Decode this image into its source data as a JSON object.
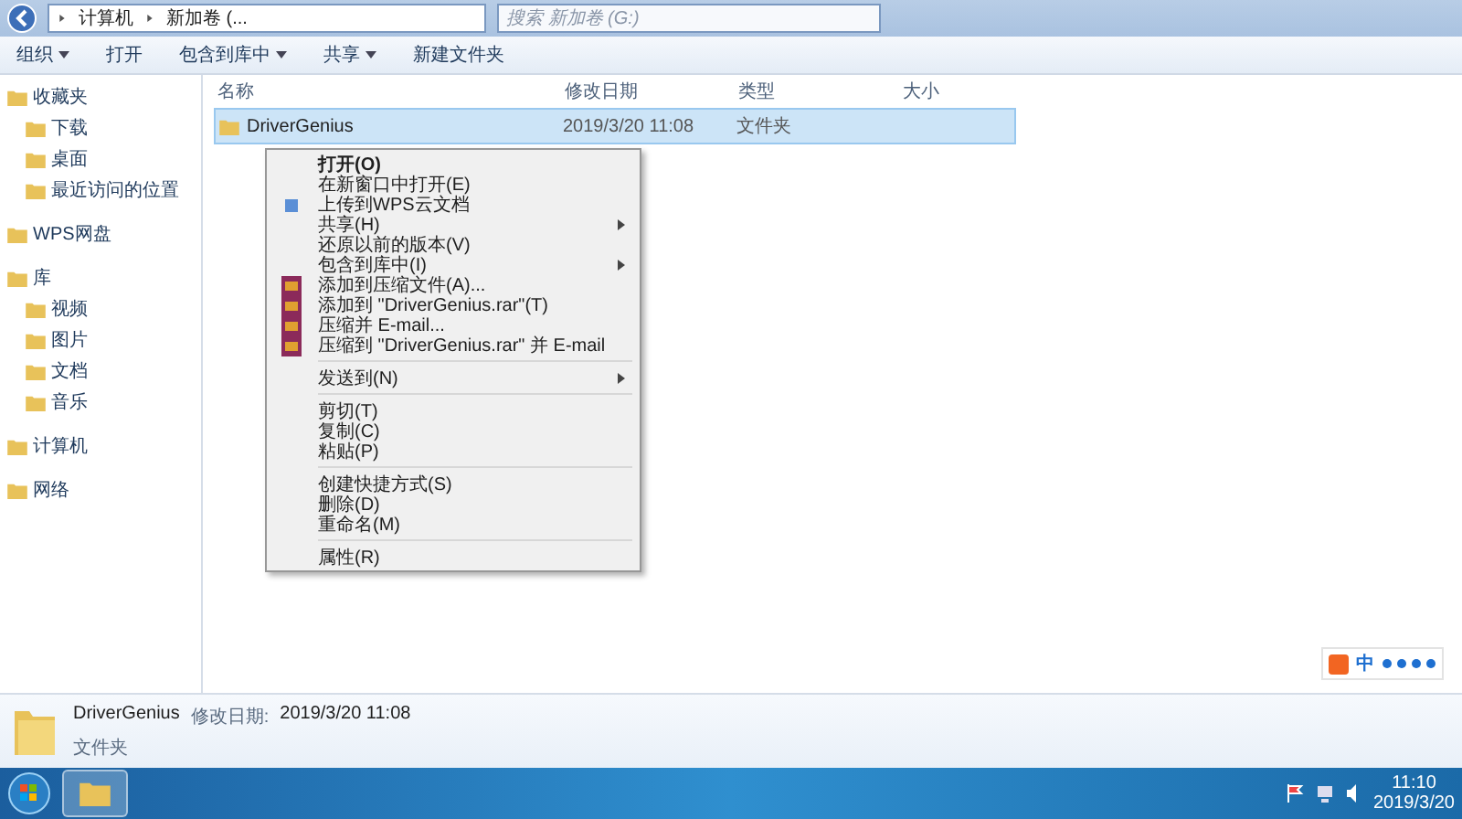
{
  "address_bar": {
    "crumbs": [
      "计算机",
      "新加卷 (..."
    ],
    "search": {
      "placeholder": "搜索 新加卷 (G:)"
    }
  },
  "toolbar": [
    {
      "label": "组织",
      "dropdown": true
    },
    {
      "label": "打开",
      "dropdown": false
    },
    {
      "label": "包含到库中",
      "dropdown": true
    },
    {
      "label": "共享",
      "dropdown": true
    },
    {
      "label": "新建文件夹",
      "dropdown": false
    }
  ],
  "sidebar": {
    "sections": [
      {
        "label": "收藏夹",
        "children": [
          {
            "label": "下载"
          },
          {
            "label": "桌面"
          },
          {
            "label": "最近访问的位置"
          }
        ]
      },
      {
        "label": "WPS网盘"
      },
      {
        "label": "库",
        "children": [
          {
            "label": "视频"
          },
          {
            "label": "图片"
          },
          {
            "label": "文档"
          },
          {
            "label": "音乐"
          }
        ]
      },
      {
        "label": "计算机"
      },
      {
        "label": "网络"
      }
    ]
  },
  "table": {
    "columns": [
      "名称",
      "修改日期",
      "类型",
      "大小"
    ],
    "rows": [
      {
        "name": "DriverGenius",
        "modified": "2019/3/20 11:08",
        "type": "文件夹",
        "selected": true
      }
    ]
  },
  "context_menu": [
    {
      "kind": "text",
      "label": "打开(O)",
      "bold": true,
      "submenu": false
    },
    {
      "kind": "text",
      "label": "在新窗口中打开(E)",
      "bold": false,
      "submenu": false
    },
    {
      "kind": "upload",
      "label": "上传到WPS云文档",
      "bold": false,
      "submenu": false
    },
    {
      "kind": "text",
      "label": "共享(H)",
      "bold": false,
      "submenu": true
    },
    {
      "kind": "text",
      "label": "还原以前的版本(V)",
      "bold": false,
      "submenu": false
    },
    {
      "kind": "text",
      "label": "包含到库中(I)",
      "bold": false,
      "submenu": true
    },
    {
      "kind": "archive",
      "label": "添加到压缩文件(A)...",
      "bold": false,
      "submenu": false
    },
    {
      "kind": "archive",
      "label": "添加到 \"DriverGenius.rar\"(T)",
      "bold": false,
      "submenu": false
    },
    {
      "kind": "archive",
      "label": "压缩并 E-mail...",
      "bold": false,
      "submenu": false
    },
    {
      "kind": "archive",
      "label": "压缩到 \"DriverGenius.rar\" 并 E-mail",
      "bold": false,
      "submenu": false
    },
    {
      "kind": "separator"
    },
    {
      "kind": "text",
      "label": "发送到(N)",
      "bold": false,
      "submenu": true
    },
    {
      "kind": "separator"
    },
    {
      "kind": "text",
      "label": "剪切(T)",
      "bold": false,
      "submenu": false
    },
    {
      "kind": "text",
      "label": "复制(C)",
      "bold": false,
      "submenu": false
    },
    {
      "kind": "text",
      "label": "粘贴(P)",
      "bold": false,
      "submenu": false
    },
    {
      "kind": "separator"
    },
    {
      "kind": "text",
      "label": "创建快捷方式(S)",
      "bold": false,
      "submenu": false
    },
    {
      "kind": "text",
      "label": "删除(D)",
      "bold": false,
      "submenu": false
    },
    {
      "kind": "text",
      "label": "重命名(M)",
      "bold": false,
      "submenu": false
    },
    {
      "kind": "separator"
    },
    {
      "kind": "text",
      "label": "属性(R)",
      "bold": false,
      "submenu": false
    }
  ],
  "details_pane": {
    "name": "DriverGenius",
    "modified_label": "修改日期:",
    "modified": "2019/3/20 11:08",
    "type": "文件夹"
  },
  "ime_bar": {
    "mode": "中"
  },
  "taskbar": {
    "time": "11:10",
    "date": "2019/3/20"
  }
}
